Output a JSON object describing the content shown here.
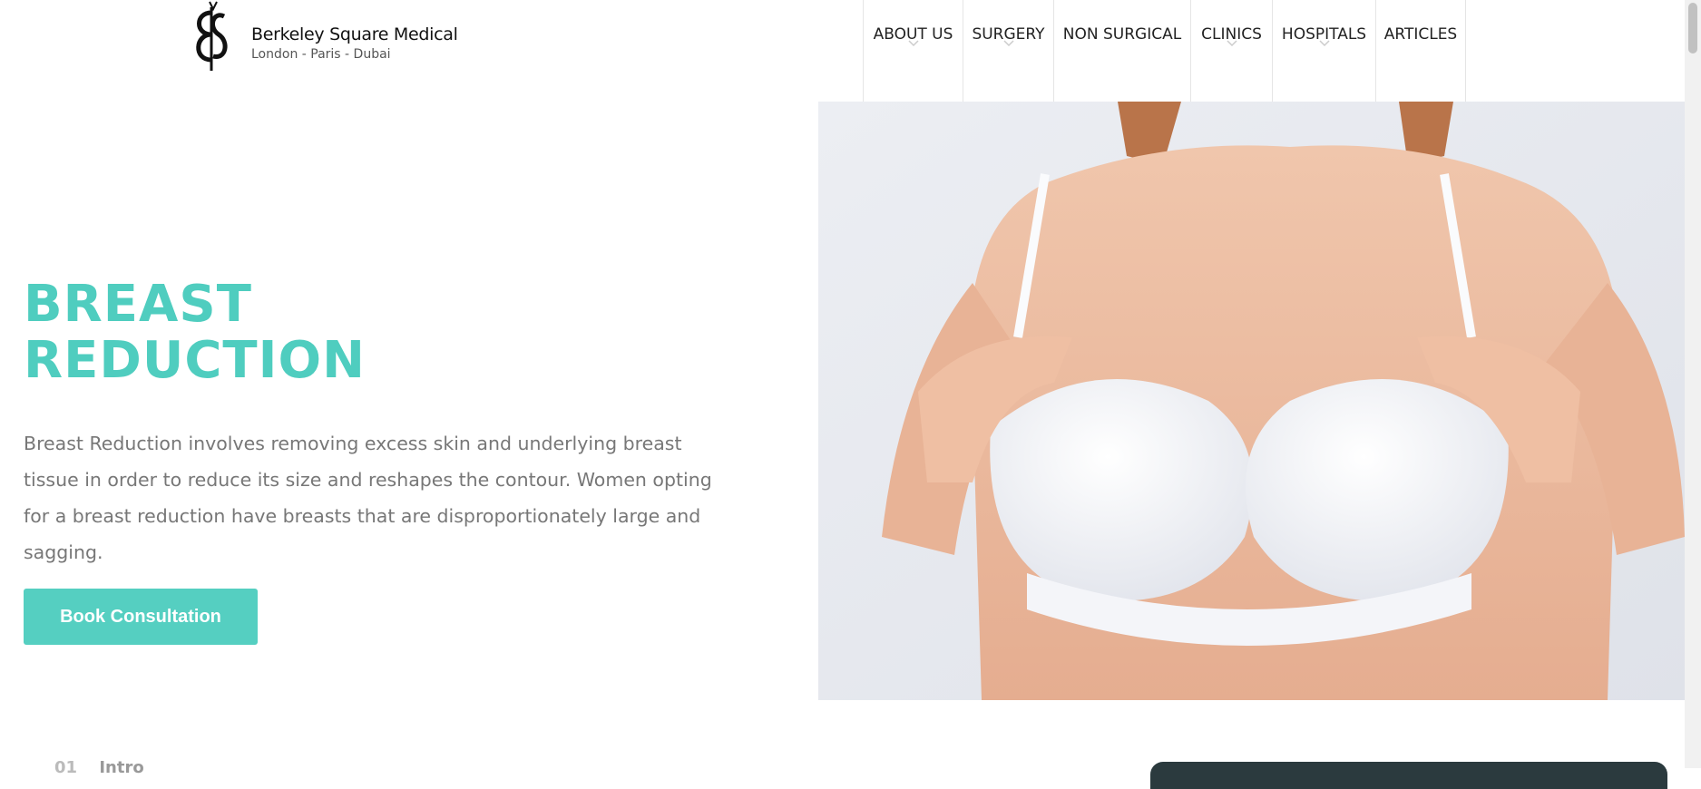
{
  "brand": {
    "name": "Berkeley Square Medical",
    "locations": "London - Paris - Dubai"
  },
  "nav": [
    {
      "label": "ABOUT US",
      "has_dropdown": true
    },
    {
      "label": "SURGERY",
      "has_dropdown": true
    },
    {
      "label": "NON SURGICAL",
      "has_dropdown": false
    },
    {
      "label": "CLINICS",
      "has_dropdown": true
    },
    {
      "label": "HOSPITALS",
      "has_dropdown": true
    },
    {
      "label": "ARTICLES",
      "has_dropdown": false
    }
  ],
  "hero": {
    "title_line1": "BREAST",
    "title_line2": "REDUCTION",
    "description": "Breast Reduction involves removing excess skin and underlying breast tissue in order to reduce its size and reshapes the contour. Women opting for a breast reduction have breasts that are disproportionately large and sagging.",
    "cta_label": "Book Consultation"
  },
  "section": {
    "number": "01",
    "label": "Intro"
  },
  "colors": {
    "accent": "#4fcdbf",
    "button": "#55cfc1",
    "dark_card": "#2b3a3e"
  }
}
